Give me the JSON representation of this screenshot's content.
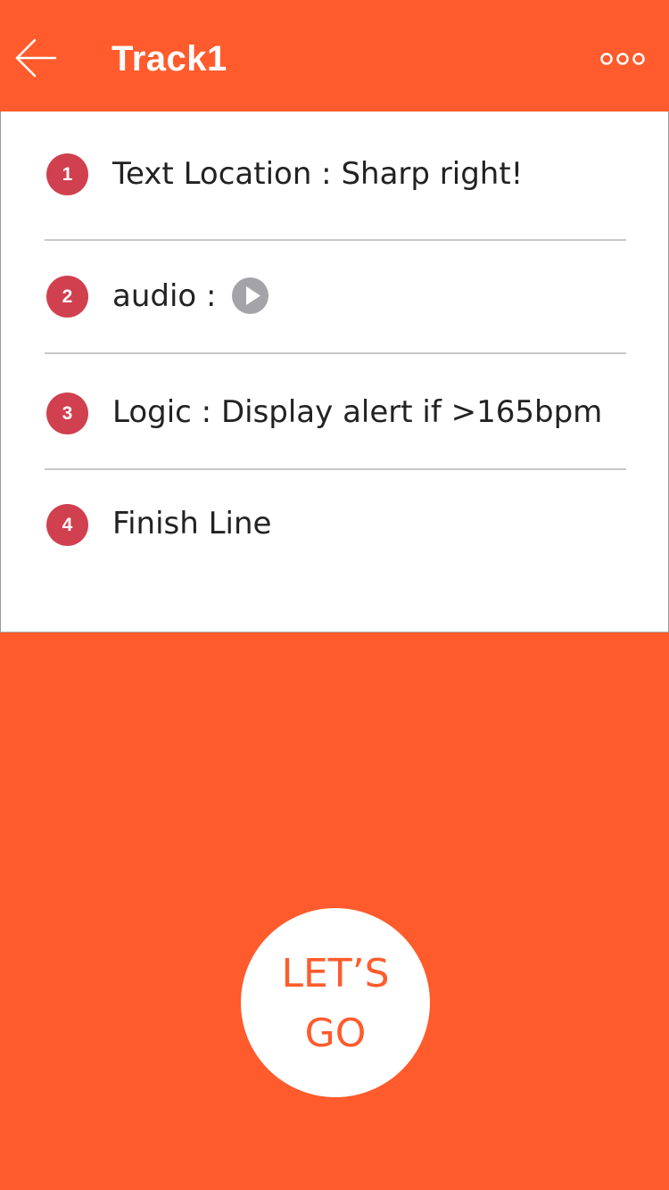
{
  "header": {
    "title": "Track1",
    "back_icon": "back-arrow-icon",
    "more_icon": "more-dots-icon"
  },
  "steps": [
    {
      "number": "1",
      "text": "Text Location : Sharp right!"
    },
    {
      "number": "2",
      "text": "audio :",
      "icon": "play-icon"
    },
    {
      "number": "3",
      "text": "Logic : Display alert if >165bpm"
    },
    {
      "number": "4",
      "text": "Finish Line"
    }
  ],
  "go_button": {
    "line1": "LET’S",
    "line2": "GO"
  },
  "colors": {
    "accent": "#FF5B2C",
    "badge": "#D0404F",
    "play": "#A4A4A8"
  }
}
